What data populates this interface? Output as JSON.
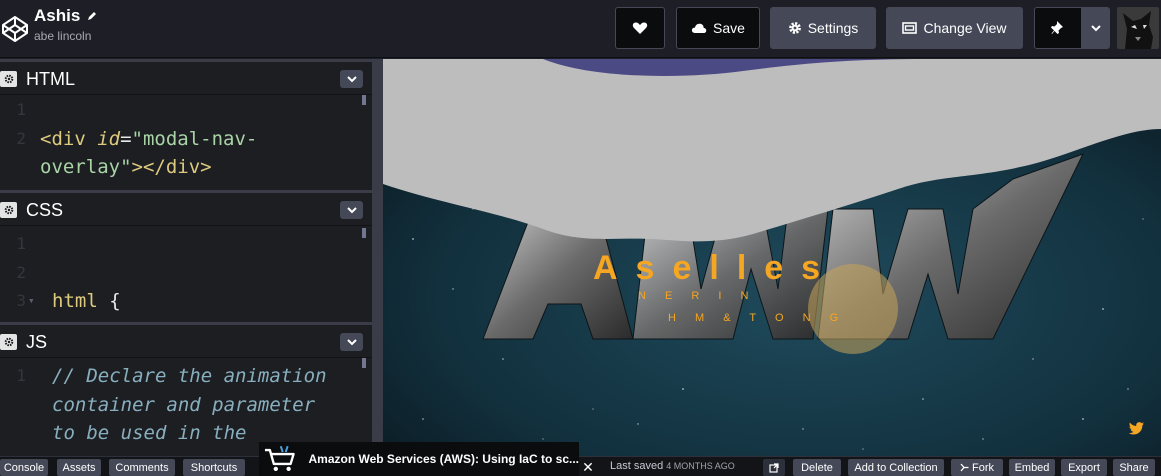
{
  "header": {
    "pen_title": "Ashis",
    "author": "abe lincoln",
    "buttons": {
      "save": "Save",
      "settings": "Settings",
      "change_view": "Change View"
    }
  },
  "editors": {
    "html": {
      "title": "HTML",
      "lines": [
        {
          "num": "1",
          "parts": []
        },
        {
          "num": "2",
          "parts": [
            {
              "cls": "tag",
              "text": "<div "
            },
            {
              "cls": "attr",
              "text": "id"
            },
            {
              "cls": "plain",
              "text": "="
            },
            {
              "cls": "str",
              "text": "\"modal-nav-"
            }
          ]
        },
        {
          "num": "",
          "parts": [
            {
              "cls": "str",
              "text": "overlay\""
            },
            {
              "cls": "tag",
              "text": "></div>"
            }
          ]
        }
      ]
    },
    "css": {
      "title": "CSS",
      "lines": [
        {
          "num": "1",
          "parts": []
        },
        {
          "num": "2",
          "parts": []
        },
        {
          "num": "3",
          "fold": true,
          "parts": [
            {
              "cls": "tag",
              "text": "html "
            },
            {
              "cls": "plain",
              "text": "{"
            }
          ]
        }
      ]
    },
    "js": {
      "title": "JS",
      "lines": [
        {
          "num": "1",
          "parts": [
            {
              "cls": "cm",
              "text": "// Declare the animation"
            }
          ]
        },
        {
          "num": "",
          "parts": [
            {
              "cls": "cm",
              "text": "container and parameter"
            }
          ]
        },
        {
          "num": "",
          "parts": [
            {
              "cls": "cm",
              "text": "to be used in the"
            }
          ]
        }
      ]
    }
  },
  "preview": {
    "big_letters": "AWW",
    "overlay_word": "Aselles",
    "overlay_sub_1": "N E R I N",
    "overlay_sub_2": "H M & T O N G"
  },
  "footer": {
    "console": "Console",
    "assets": "Assets",
    "comments": "Comments",
    "shortcuts": "Shortcuts",
    "ad_text": "Amazon Web Services (AWS): Using IaC to sc...",
    "close": "✕",
    "last_saved": "Last saved",
    "saved_when": "4 months ago",
    "delete": "Delete",
    "add_to_collection": "Add to Collection",
    "fork": "Fork",
    "embed": "Embed",
    "export": "Export",
    "share": "Share"
  },
  "colors": {
    "accent_gold": "#f5a623",
    "button_gray": "#444857",
    "header_bg": "#1e1f26",
    "editor_bg": "#1d1e22"
  }
}
